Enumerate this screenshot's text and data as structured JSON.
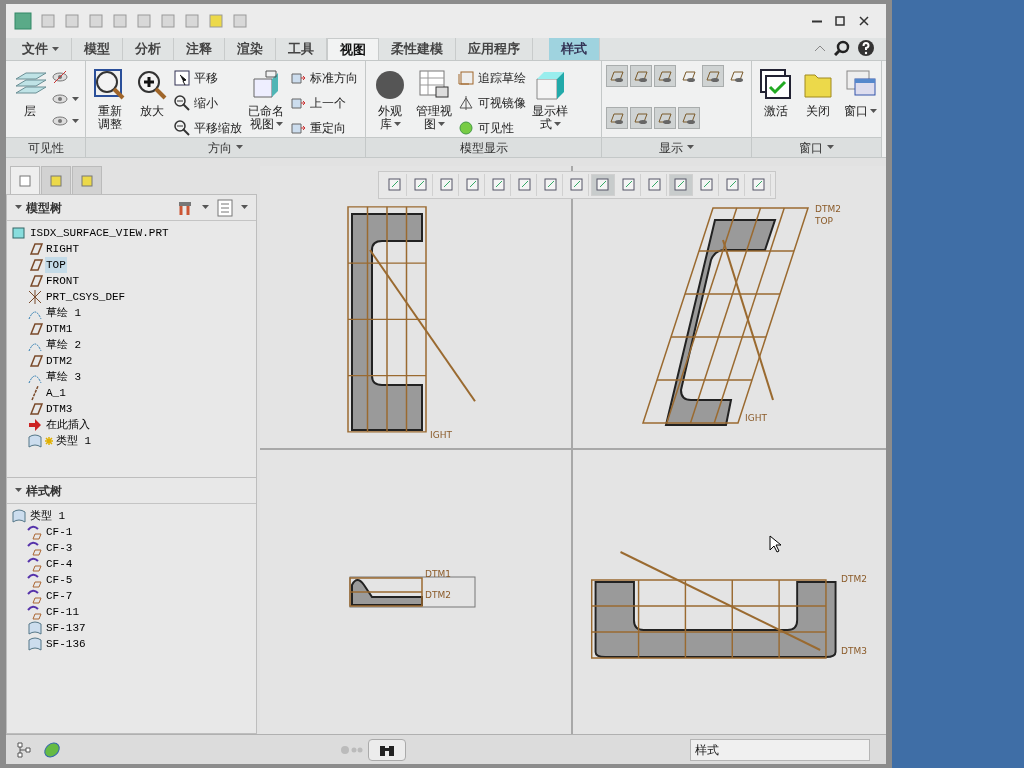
{
  "tabs": [
    {
      "label": "文件",
      "kind": "menu",
      "selected": false
    },
    {
      "label": "模型",
      "kind": "tab",
      "selected": false
    },
    {
      "label": "分析",
      "kind": "tab",
      "selected": false
    },
    {
      "label": "注释",
      "kind": "tab",
      "selected": false
    },
    {
      "label": "渲染",
      "kind": "tab",
      "selected": false
    },
    {
      "label": "工具",
      "kind": "tab",
      "selected": false
    },
    {
      "label": "视图",
      "kind": "tab",
      "selected": true
    },
    {
      "label": "柔性建模",
      "kind": "tab",
      "selected": false
    },
    {
      "label": "应用程序",
      "kind": "tab",
      "selected": false
    },
    {
      "label": "样式",
      "kind": "contextual",
      "selected": false
    }
  ],
  "ribbon_groups": [
    {
      "label": "可见性",
      "menu": false,
      "items": [
        {
          "kind": "large",
          "lines": [
            "层"
          ],
          "caret": false
        },
        {
          "kind": "icon_stack",
          "items": [
            {
              "caret": false
            },
            {
              "caret": true
            },
            {
              "caret": true
            }
          ]
        }
      ]
    },
    {
      "label": "方向",
      "menu": true,
      "items": [
        {
          "kind": "large",
          "lines": [
            "重新",
            "调整"
          ],
          "caret": false
        },
        {
          "kind": "large",
          "lines": [
            "放大"
          ],
          "caret": false
        },
        {
          "kind": "small_stack",
          "items": [
            "平移",
            "缩小",
            "平移缩放"
          ]
        },
        {
          "kind": "large",
          "lines": [
            "已命名",
            "视图"
          ],
          "caret": true
        },
        {
          "kind": "small_stack",
          "items": [
            "标准方向",
            "上一个",
            "重定向"
          ]
        }
      ]
    },
    {
      "label": "模型显示",
      "menu": false,
      "items": [
        {
          "kind": "large",
          "lines": [
            "外观",
            "库"
          ],
          "caret": true
        },
        {
          "kind": "large",
          "lines": [
            "管理视",
            "图"
          ],
          "caret": true
        },
        {
          "kind": "small_stack",
          "items": [
            "追踪草绘",
            "可视镜像",
            "可见性"
          ]
        },
        {
          "kind": "large",
          "lines": [
            "显示样",
            "式"
          ],
          "caret": true
        }
      ]
    },
    {
      "label": "显示",
      "menu": true,
      "items": [
        {
          "kind": "toggle_grid",
          "rows": [
            [
              {
                "selected": true
              },
              {
                "selected": true
              },
              {
                "selected": true
              },
              {
                "selected": false
              },
              {
                "selected": true
              },
              {
                "selected": false
              }
            ],
            [
              {
                "selected": true
              },
              {
                "selected": true
              },
              {
                "selected": true
              },
              {
                "selected": true
              }
            ]
          ]
        }
      ]
    },
    {
      "label": "窗口",
      "menu": true,
      "items": [
        {
          "kind": "large",
          "lines": [
            "激活"
          ],
          "caret": false
        },
        {
          "kind": "large",
          "lines": [
            "关闭"
          ],
          "caret": false
        },
        {
          "kind": "large",
          "lines": [
            "窗口"
          ],
          "caret": true
        }
      ]
    }
  ],
  "panel_tabs": [
    {
      "selected": true
    },
    {
      "selected": false
    },
    {
      "selected": false
    }
  ],
  "model_tree": {
    "title": "模型树",
    "items": [
      {
        "label": "ISDX_SURFACE_VIEW.PRT",
        "kind": "part",
        "selected": false,
        "children": [
          {
            "label": "RIGHT",
            "kind": "plane",
            "selected": false
          },
          {
            "label": "TOP",
            "kind": "plane",
            "selected": true
          },
          {
            "label": "FRONT",
            "kind": "plane",
            "selected": false
          },
          {
            "label": "PRT_CSYS_DEF",
            "kind": "csys",
            "selected": false
          },
          {
            "label": "草绘 1",
            "kind": "sketch",
            "selected": false
          },
          {
            "label": "DTM1",
            "kind": "plane",
            "selected": false
          },
          {
            "label": "草绘 2",
            "kind": "sketch",
            "selected": false
          },
          {
            "label": "DTM2",
            "kind": "plane",
            "selected": false
          },
          {
            "label": "草绘 3",
            "kind": "sketch",
            "selected": false
          },
          {
            "label": "A_1",
            "kind": "axis",
            "selected": false
          },
          {
            "label": "DTM3",
            "kind": "plane",
            "selected": false
          },
          {
            "label": "在此插入",
            "kind": "insert",
            "selected": false
          },
          {
            "label": "类型 1",
            "kind": "style",
            "selected": false
          }
        ]
      }
    ]
  },
  "style_tree": {
    "title": "样式树",
    "items": [
      {
        "label": "类型 1",
        "kind": "surface",
        "selected": false,
        "children": [
          {
            "label": "CF-1",
            "kind": "curve",
            "selected": false
          },
          {
            "label": "CF-3",
            "kind": "curve",
            "selected": false
          },
          {
            "label": "CF-4",
            "kind": "curve",
            "selected": false
          },
          {
            "label": "CF-5",
            "kind": "curve",
            "selected": false
          },
          {
            "label": "CF-7",
            "kind": "curve",
            "selected": false
          },
          {
            "label": "CF-11",
            "kind": "curve",
            "selected": false
          },
          {
            "label": "SF-137",
            "kind": "surface",
            "selected": false
          },
          {
            "label": "SF-136",
            "kind": "surface",
            "selected": false
          }
        ]
      }
    ]
  },
  "view_toolbar": [
    {
      "selected": false
    },
    {
      "selected": false
    },
    {
      "selected": false
    },
    {
      "selected": false
    },
    {
      "selected": false
    },
    {
      "selected": false
    },
    {
      "selected": false
    },
    {
      "selected": false
    },
    {
      "selected": true
    },
    {
      "selected": false
    },
    {
      "selected": false
    },
    {
      "selected": true
    },
    {
      "selected": false
    },
    {
      "selected": false
    },
    {
      "selected": false
    }
  ],
  "viewports": [
    {
      "labels": [
        "IGHT"
      ]
    },
    {
      "labels": [
        "DTM2",
        "TOP",
        "IGHT"
      ]
    },
    {
      "labels": [
        "DTM1",
        "DTM2"
      ]
    },
    {
      "labels": [
        "DTM2",
        "DTM3"
      ]
    }
  ],
  "status_bar": {
    "filter": "样式"
  }
}
